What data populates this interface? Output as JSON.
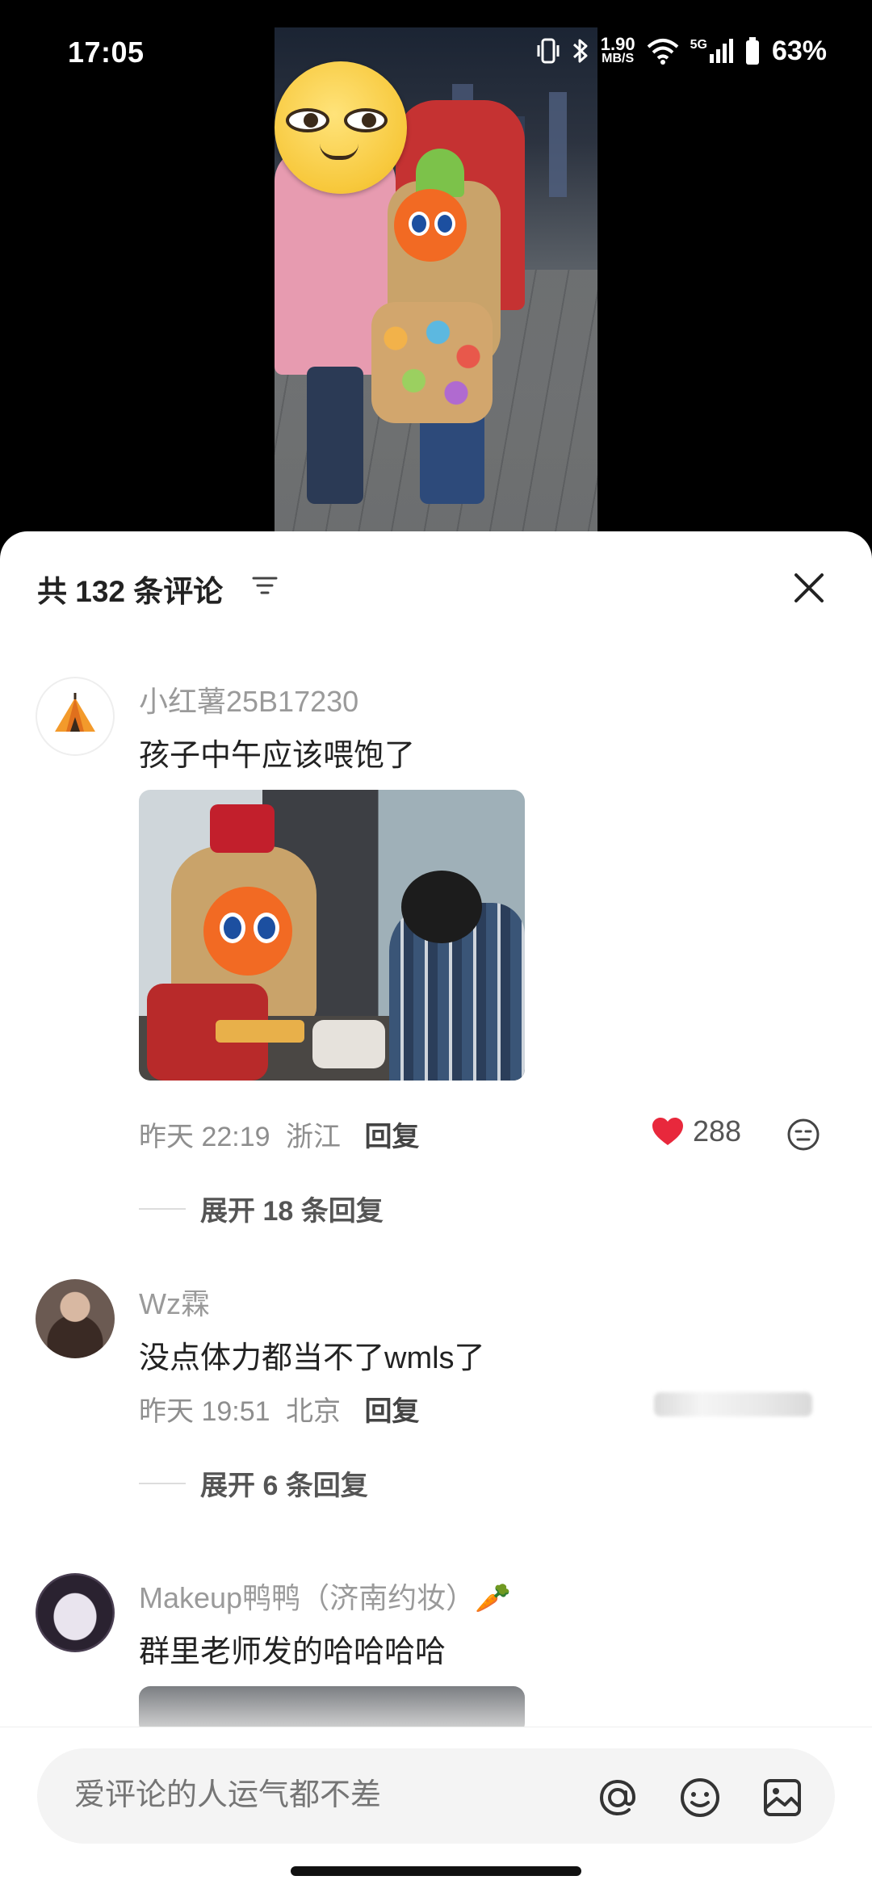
{
  "status_bar": {
    "time": "17:05",
    "net_speed_value": "1.90",
    "net_speed_unit": "MB/S",
    "signal_label": "5G",
    "battery": "63%"
  },
  "sheet": {
    "title": "共 132 条评论"
  },
  "comments": [
    {
      "username": "小红薯25B17230",
      "text": "孩子中午应该喂饱了",
      "time": "昨天 22:19",
      "location": "浙江",
      "reply_label": "回复",
      "likes": "288",
      "liked": true,
      "expand_label": "展开 18 条回复"
    },
    {
      "username": "Wz霖",
      "text": "没点体力都当不了wmls了",
      "time": "昨天 19:51",
      "location": "北京",
      "reply_label": "回复",
      "expand_label": "展开 6 条回复"
    },
    {
      "username": "Makeup鸭鸭（济南约妆）🥕",
      "text": "群里老师发的哈哈哈哈"
    }
  ],
  "input": {
    "placeholder": "爱评论的人运气都不差"
  },
  "colors": {
    "like_red": "#e8283c",
    "accent_orange": "#f26a23"
  }
}
